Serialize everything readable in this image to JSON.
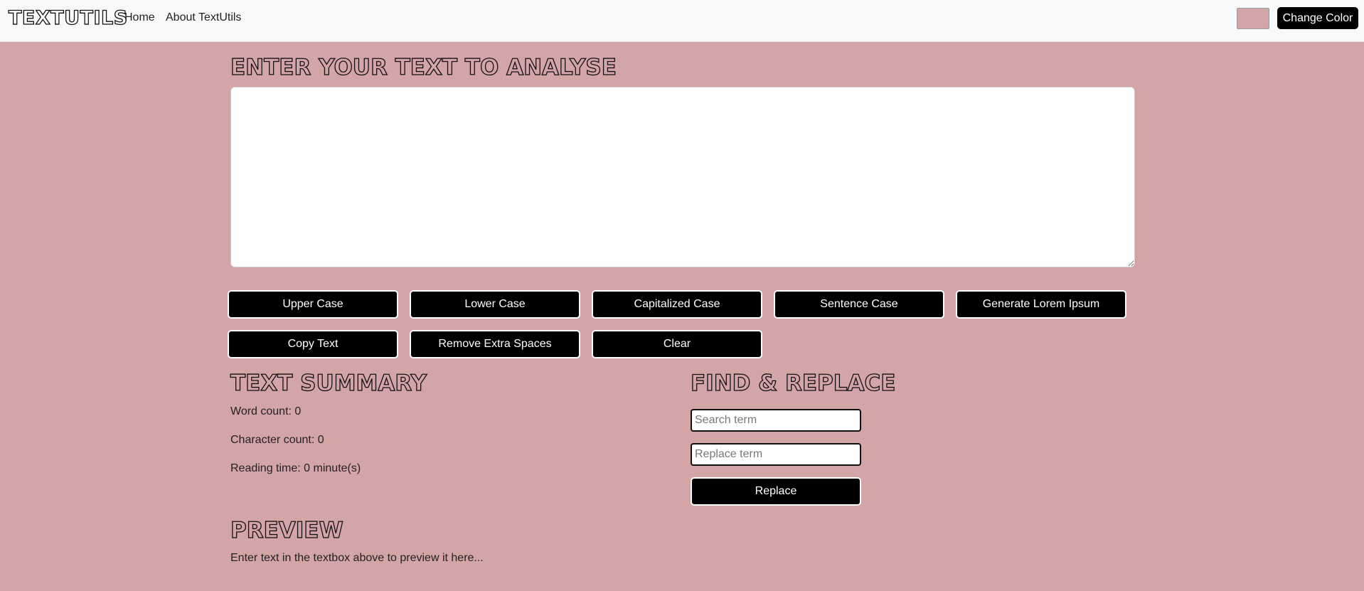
{
  "navbar": {
    "brand": "TEXTUTILS",
    "links": [
      "Home",
      "About TextUtils"
    ],
    "color_picker_value": "#d4a5a7",
    "change_color_label": "Change Color"
  },
  "main": {
    "heading": "ENTER YOUR TEXT TO ANALYSE",
    "textarea_value": "",
    "buttons": [
      "Upper Case",
      "Lower Case",
      "Capitalized Case",
      "Sentence Case",
      "Generate Lorem Ipsum",
      "Copy Text",
      "Remove Extra Spaces",
      "Clear"
    ]
  },
  "summary": {
    "heading": "TEXT SUMMARY",
    "word_count": "Word count: 0",
    "character_count": "Character count: 0",
    "reading_time": "Reading time: 0 minute(s)"
  },
  "find_replace": {
    "heading": "FIND & REPLACE",
    "search_placeholder": "Search term",
    "replace_placeholder": "Replace term",
    "button_label": "Replace"
  },
  "preview": {
    "heading": "PREVIEW",
    "text": "Enter text in the textbox above to preview it here..."
  },
  "colors": {
    "background": "#d4a5a7",
    "navbar": "#f8f9fa",
    "button": "#000000",
    "button_text": "#ffffff"
  }
}
